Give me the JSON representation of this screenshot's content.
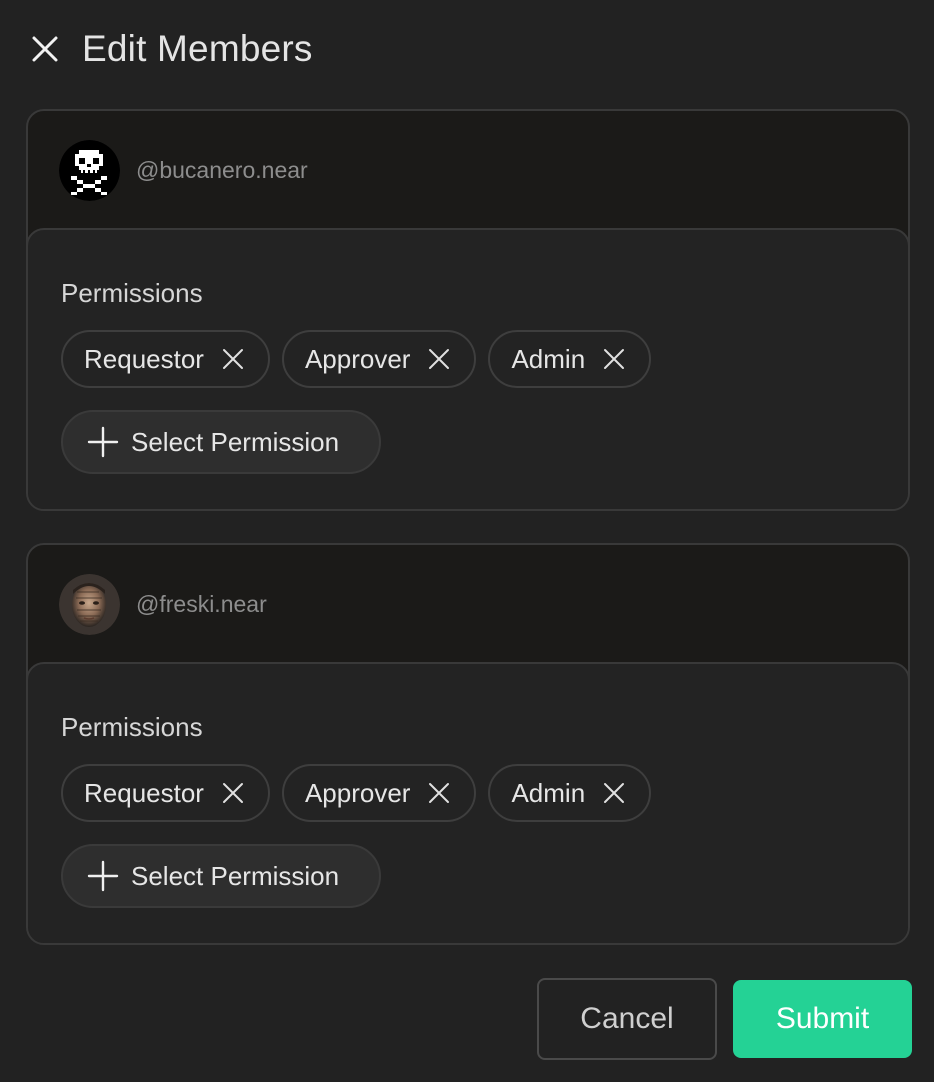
{
  "header": {
    "title": "Edit Members",
    "close_icon": "close-icon"
  },
  "members": [
    {
      "handle": "@bucanero.near",
      "avatar": "pixel-skull-avatar",
      "permissions_label": "Permissions",
      "permissions": [
        "Requestor",
        "Approver",
        "Admin"
      ],
      "select_label": "Select Permission"
    },
    {
      "handle": "@freski.near",
      "avatar": "photo-avatar",
      "permissions_label": "Permissions",
      "permissions": [
        "Requestor",
        "Approver",
        "Admin"
      ],
      "select_label": "Select Permission"
    }
  ],
  "footer": {
    "cancel_label": "Cancel",
    "submit_label": "Submit"
  },
  "colors": {
    "background": "#222222",
    "card_background": "#1b1a18",
    "border": "#393939",
    "accent": "#24d295",
    "handle_text": "#8d8d8d"
  }
}
